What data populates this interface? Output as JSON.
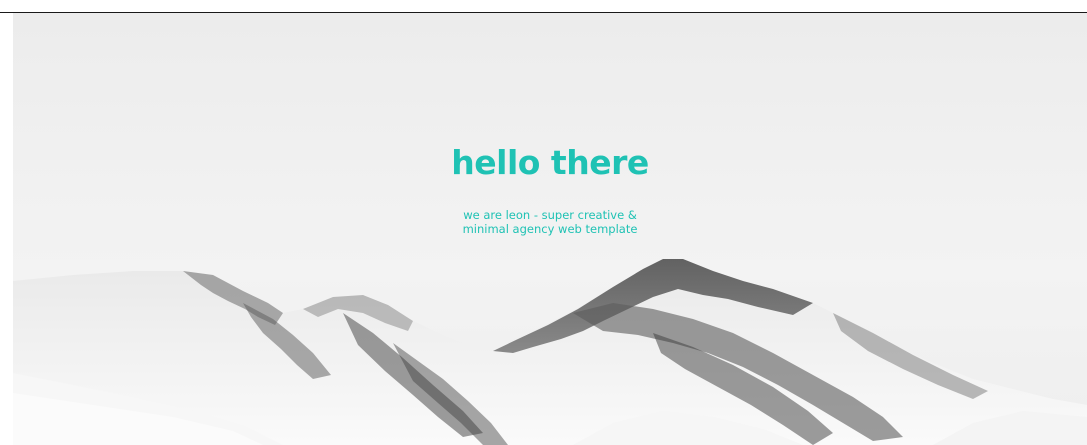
{
  "hero": {
    "title": "hello there",
    "subtitle_line1": "we are leon - super creative &",
    "subtitle_line2": "minimal agency web template"
  },
  "colors": {
    "accent": "#1fc2b4",
    "background": "#f1f1f1",
    "snow": "#f6f6f6",
    "rock": "#3a3a3a"
  }
}
